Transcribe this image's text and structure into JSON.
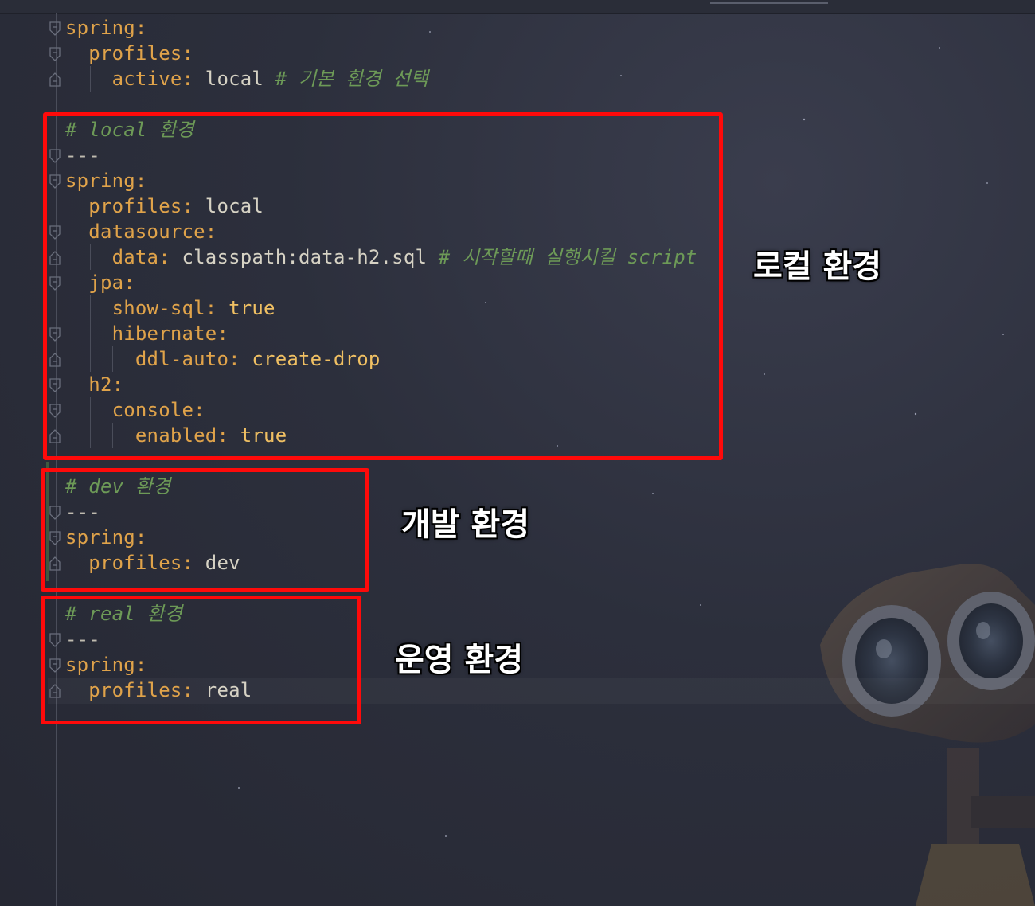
{
  "editor": {
    "lines": [
      {
        "parts": [
          {
            "t": "spring:",
            "c": "key"
          }
        ]
      },
      {
        "parts": [
          {
            "t": "  profiles:",
            "c": "key"
          }
        ]
      },
      {
        "parts": [
          {
            "t": "    active: ",
            "c": "key"
          },
          {
            "t": "local",
            "c": "val"
          },
          {
            "t": " # 기본 환경 선택",
            "c": "cmt"
          }
        ]
      },
      {
        "parts": []
      },
      {
        "parts": [
          {
            "t": "# local 환경",
            "c": "cmt"
          }
        ]
      },
      {
        "parts": [
          {
            "t": "---",
            "c": "sep"
          }
        ]
      },
      {
        "parts": [
          {
            "t": "spring:",
            "c": "key"
          }
        ]
      },
      {
        "parts": [
          {
            "t": "  profiles: ",
            "c": "key"
          },
          {
            "t": "local",
            "c": "val"
          }
        ]
      },
      {
        "parts": [
          {
            "t": "  datasource:",
            "c": "key"
          }
        ]
      },
      {
        "parts": [
          {
            "t": "    data: ",
            "c": "key"
          },
          {
            "t": "classpath:data-h2.sql",
            "c": "val"
          },
          {
            "t": " # 시작할때 실행시킬 script",
            "c": "cmt"
          }
        ]
      },
      {
        "parts": [
          {
            "t": "  jpa:",
            "c": "key"
          }
        ]
      },
      {
        "parts": [
          {
            "t": "    show-sql: ",
            "c": "key"
          },
          {
            "t": "true",
            "c": "bool"
          }
        ]
      },
      {
        "parts": [
          {
            "t": "    hibernate:",
            "c": "key"
          }
        ]
      },
      {
        "parts": [
          {
            "t": "      ddl-auto: ",
            "c": "key"
          },
          {
            "t": "create-drop",
            "c": "bool"
          }
        ]
      },
      {
        "parts": [
          {
            "t": "  h2:",
            "c": "key"
          }
        ]
      },
      {
        "parts": [
          {
            "t": "    console:",
            "c": "key"
          }
        ]
      },
      {
        "parts": [
          {
            "t": "      enabled: ",
            "c": "key"
          },
          {
            "t": "true",
            "c": "bool"
          }
        ]
      },
      {
        "parts": []
      },
      {
        "parts": [
          {
            "t": "# dev 환경",
            "c": "cmt"
          }
        ]
      },
      {
        "parts": [
          {
            "t": "---",
            "c": "sep"
          }
        ]
      },
      {
        "parts": [
          {
            "t": "spring:",
            "c": "key"
          }
        ]
      },
      {
        "parts": [
          {
            "t": "  profiles: ",
            "c": "key"
          },
          {
            "t": "dev",
            "c": "val"
          }
        ]
      },
      {
        "parts": []
      },
      {
        "parts": [
          {
            "t": "# real 환경",
            "c": "cmt"
          }
        ]
      },
      {
        "parts": [
          {
            "t": "---",
            "c": "sep"
          }
        ]
      },
      {
        "parts": [
          {
            "t": "spring:",
            "c": "key"
          }
        ]
      },
      {
        "parts": [
          {
            "t": "  profiles: ",
            "c": "key"
          },
          {
            "t": "real",
            "c": "val"
          }
        ]
      }
    ]
  },
  "annotations": {
    "local": "로컬 환경",
    "dev": "개발 환경",
    "real": "운영 환경"
  },
  "colors": {
    "highlight_box": "#ff0a0a",
    "key": "#e0a34a",
    "comment": "#6d9a57",
    "value": "#d6d2c4"
  },
  "icons": {
    "fold_open": "fold-open-icon",
    "fold_close": "fold-close-icon"
  }
}
